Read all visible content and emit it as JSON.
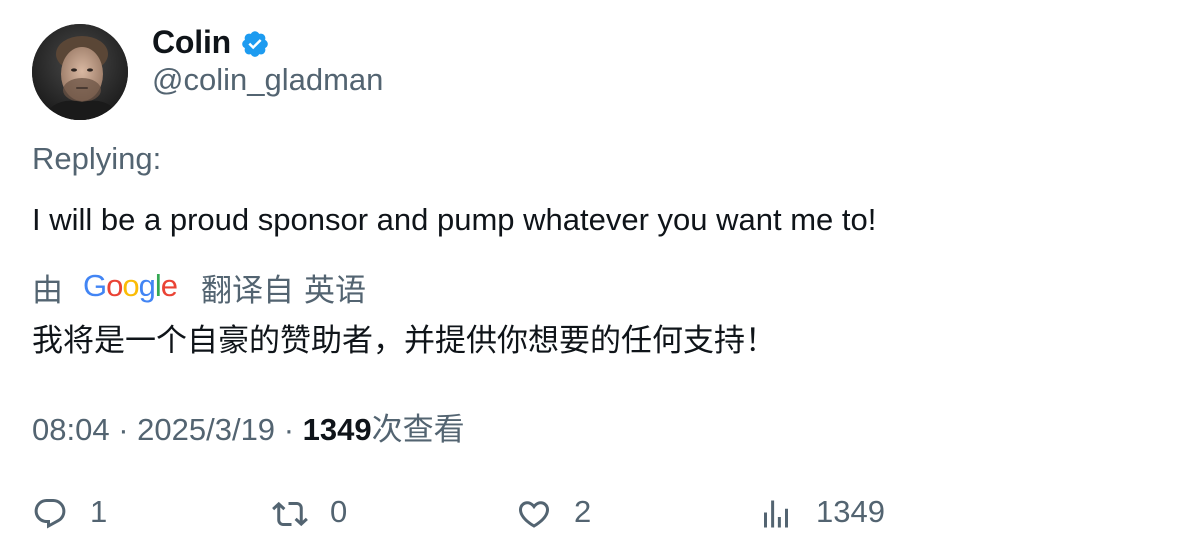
{
  "author": {
    "display_name": "Colin",
    "handle": "@colin_gladman",
    "verified": true,
    "verified_color": "#1d9bf0"
  },
  "tweet": {
    "replying_label": "Replying:",
    "text": "I will be a proud sponsor and pump whatever you want me to!",
    "translation": {
      "by_label": "由",
      "provider": "Google",
      "translated_from_label": "翻译自",
      "source_language": "英语",
      "text": "我将是一个自豪的赞助者，并提供你想要的任何支持！"
    },
    "time": "08:04",
    "separator": "·",
    "date": "2025/3/19",
    "views_count": "1349",
    "views_label": "次查看"
  },
  "actions": {
    "reply": {
      "icon": "reply-icon",
      "count": "1"
    },
    "retweet": {
      "icon": "retweet-icon",
      "count": "0"
    },
    "like": {
      "icon": "heart-icon",
      "count": "2"
    },
    "views": {
      "icon": "views-chart-icon",
      "count": "1349"
    }
  },
  "colors": {
    "text_primary": "#0f1419",
    "text_secondary": "#536471",
    "accent": "#1d9bf0"
  }
}
